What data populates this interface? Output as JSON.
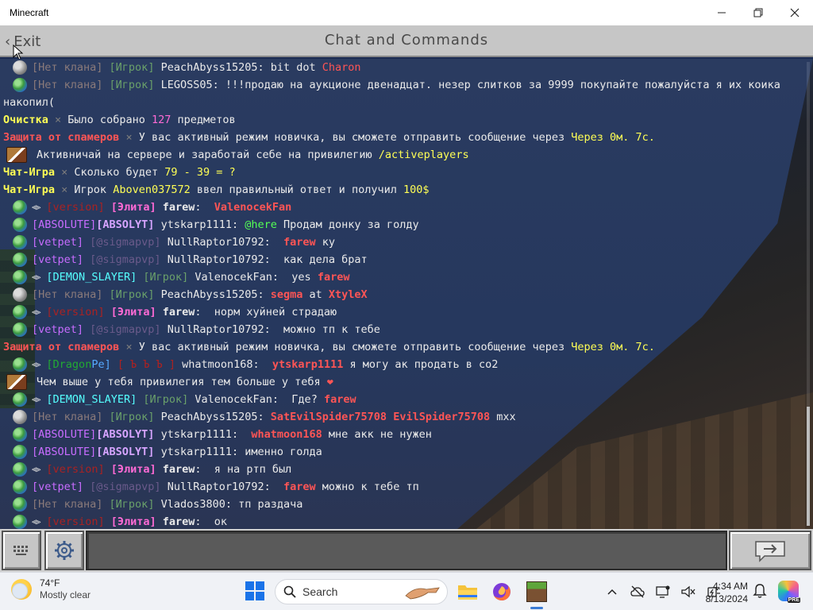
{
  "window": {
    "title": "Minecraft"
  },
  "header": {
    "exit_label": "Exit",
    "title": "Chat and Commands"
  },
  "colors": {
    "gray": "#7d7d7d",
    "white": "#eaeaea",
    "yellow": "#ffff55",
    "gold": "#ffd24a",
    "red": "#ff5555",
    "pink": "#ff6ad5",
    "purple": "#c86cff",
    "aqua": "#55ffff",
    "green": "#55ff55",
    "dark_red": "#aa2222",
    "dark_green": "#22aa33",
    "lavender": "#d6a4ff"
  },
  "chat_lines": [
    {
      "avatar": "gray",
      "wing": false,
      "segments": [
        {
          "t": "[Нет клана] ",
          "c": "#8a7a7a"
        },
        {
          "t": "[Игрок] ",
          "c": "#6aa06a"
        },
        {
          "t": "PeachAbyss15205",
          "c": "#eaeaea"
        },
        {
          "t": ": bit dot ",
          "c": "#eaeaea"
        },
        {
          "t": "Charon",
          "c": "#ff5555"
        }
      ]
    },
    {
      "avatar": "globe",
      "wing": false,
      "segments": [
        {
          "t": "[Нет клана] ",
          "c": "#8a7a7a"
        },
        {
          "t": "[Игрок] ",
          "c": "#6aa06a"
        },
        {
          "t": "LEGOSS05",
          "c": "#eaeaea"
        },
        {
          "t": ": !!!продаю на аукционе двенадцат. незер слитков за 9999 покупайте пожалуйста я их коика",
          "c": "#eaeaea"
        }
      ]
    },
    {
      "avatar": "none",
      "wing": false,
      "segments": [
        {
          "t": "накопил(",
          "c": "#eaeaea"
        }
      ]
    },
    {
      "avatar": "none",
      "wing": false,
      "segments": [
        {
          "t": "Очистка ",
          "c": "#ffff55",
          "b": true
        },
        {
          "t": "× ",
          "c": "#7d7d7d"
        },
        {
          "t": "Было собрано ",
          "c": "#eaeaea"
        },
        {
          "t": "127",
          "c": "#ff6ad5"
        },
        {
          "t": " предметов",
          "c": "#eaeaea"
        }
      ]
    },
    {
      "avatar": "none",
      "wing": false,
      "segments": [
        {
          "t": "Защита от спамеров ",
          "c": "#ff5555",
          "b": true
        },
        {
          "t": "× ",
          "c": "#7d7d7d"
        },
        {
          "t": "У вас активный режим новичка, вы сможете отправить сообщение через ",
          "c": "#eaeaea"
        },
        {
          "t": "Через 0м. 7с.",
          "c": "#ffff55"
        }
      ]
    },
    {
      "avatar": "book",
      "wing": false,
      "segments": [
        {
          "t": "Активничай на сервере и заработай себе на привилегию ",
          "c": "#eaeaea"
        },
        {
          "t": "/activeplayers",
          "c": "#ffff55"
        }
      ]
    },
    {
      "avatar": "none",
      "wing": false,
      "segments": [
        {
          "t": "Чат-Игра ",
          "c": "#ffff55",
          "b": true
        },
        {
          "t": "× ",
          "c": "#7d7d7d"
        },
        {
          "t": "Сколько будет ",
          "c": "#eaeaea"
        },
        {
          "t": "79 - 39 = ?",
          "c": "#ffff55"
        }
      ]
    },
    {
      "avatar": "none",
      "wing": false,
      "segments": [
        {
          "t": "Чат-Игра ",
          "c": "#ffff55",
          "b": true
        },
        {
          "t": "× ",
          "c": "#7d7d7d"
        },
        {
          "t": "Игрок ",
          "c": "#eaeaea"
        },
        {
          "t": "Aboven037572",
          "c": "#ffff55"
        },
        {
          "t": " ввел правильный ответ и получил ",
          "c": "#eaeaea"
        },
        {
          "t": "100$",
          "c": "#ffff55"
        }
      ]
    },
    {
      "avatar": "globe",
      "wing": true,
      "segments": [
        {
          "t": "[version] ",
          "c": "#aa2222"
        },
        {
          "t": "[Элита] ",
          "c": "#ff6ad5",
          "b": true
        },
        {
          "t": "farew",
          "c": "#eaeaea",
          "b": true
        },
        {
          "t": ":  ",
          "c": "#eaeaea"
        },
        {
          "t": "ValenocekFan",
          "c": "#ff5555",
          "b": true
        }
      ]
    },
    {
      "avatar": "globe",
      "wing": false,
      "segments": [
        {
          "t": "[ABSOLUTE]",
          "c": "#c86cff"
        },
        {
          "t": "[ABSOLYT] ",
          "c": "#d6a4ff",
          "b": true
        },
        {
          "t": "ytskarp1111",
          "c": "#eaeaea"
        },
        {
          "t": ": ",
          "c": "#eaeaea"
        },
        {
          "t": "@here",
          "c": "#55ff55"
        },
        {
          "t": " Продам донку за голду",
          "c": "#eaeaea"
        }
      ]
    },
    {
      "avatar": "globe",
      "wing": false,
      "segments": [
        {
          "t": "[vetpet] ",
          "c": "#c86cff"
        },
        {
          "t": "[@sigmapvp] ",
          "c": "#6a5a8a"
        },
        {
          "t": "NullRaptor10792",
          "c": "#eaeaea"
        },
        {
          "t": ":  ",
          "c": "#eaeaea"
        },
        {
          "t": "farew",
          "c": "#ff5555",
          "b": true
        },
        {
          "t": " ку",
          "c": "#eaeaea"
        }
      ]
    },
    {
      "avatar": "globe",
      "wing": false,
      "segments": [
        {
          "t": "[vetpet] ",
          "c": "#c86cff"
        },
        {
          "t": "[@sigmapvp] ",
          "c": "#6a5a8a"
        },
        {
          "t": "NullRaptor10792",
          "c": "#eaeaea"
        },
        {
          "t": ":  как дела брат",
          "c": "#eaeaea"
        }
      ]
    },
    {
      "avatar": "globe",
      "wing": true,
      "segments": [
        {
          "t": "[DEMON_SLAYER] ",
          "c": "#55ffff"
        },
        {
          "t": "[Игрок] ",
          "c": "#6aa06a"
        },
        {
          "t": "ValenocekFan",
          "c": "#eaeaea"
        },
        {
          "t": ":  yes ",
          "c": "#eaeaea"
        },
        {
          "t": "farew",
          "c": "#ff5555",
          "b": true
        }
      ]
    },
    {
      "avatar": "gray",
      "wing": false,
      "segments": [
        {
          "t": "[Нет клана] ",
          "c": "#8a7a7a"
        },
        {
          "t": "[Игрок] ",
          "c": "#6aa06a"
        },
        {
          "t": "PeachAbyss15205",
          "c": "#eaeaea"
        },
        {
          "t": ": ",
          "c": "#eaeaea"
        },
        {
          "t": "segma",
          "c": "#ff5555",
          "b": true
        },
        {
          "t": " at ",
          "c": "#eaeaea"
        },
        {
          "t": "XtyleX",
          "c": "#ff5555",
          "b": true
        }
      ]
    },
    {
      "avatar": "globe",
      "wing": true,
      "segments": [
        {
          "t": "[version] ",
          "c": "#aa2222"
        },
        {
          "t": "[Элита] ",
          "c": "#ff6ad5",
          "b": true
        },
        {
          "t": "farew",
          "c": "#eaeaea",
          "b": true
        },
        {
          "t": ":  норм хуйней страдаю",
          "c": "#eaeaea"
        }
      ]
    },
    {
      "avatar": "globe",
      "wing": false,
      "segments": [
        {
          "t": "[vetpet] ",
          "c": "#c86cff"
        },
        {
          "t": "[@sigmapvp] ",
          "c": "#6a5a8a"
        },
        {
          "t": "NullRaptor10792",
          "c": "#eaeaea"
        },
        {
          "t": ":  можно тп к тебе",
          "c": "#eaeaea"
        }
      ]
    },
    {
      "avatar": "none",
      "wing": false,
      "segments": [
        {
          "t": "Защита от спамеров ",
          "c": "#ff5555",
          "b": true
        },
        {
          "t": "× ",
          "c": "#7d7d7d"
        },
        {
          "t": "У вас активный режим новичка, вы сможете отправить сообщение через ",
          "c": "#eaeaea"
        },
        {
          "t": "Через 0м. 7с.",
          "c": "#ffff55"
        }
      ]
    },
    {
      "avatar": "globe",
      "wing": true,
      "segments": [
        {
          "t": "[Dragon",
          "c": "#22aa33"
        },
        {
          "t": "Pe] ",
          "c": "#55aaff"
        },
        {
          "t": "[ Ъ Ъ Ъ ] ",
          "c": "#aa2222"
        },
        {
          "t": "whatmoon168",
          "c": "#eaeaea"
        },
        {
          "t": ":  ",
          "c": "#eaeaea"
        },
        {
          "t": "ytskarp1111",
          "c": "#ff5555",
          "b": true
        },
        {
          "t": " я могу ак продать в co2",
          "c": "#eaeaea"
        }
      ]
    },
    {
      "avatar": "book",
      "wing": false,
      "segments": [
        {
          "t": "Чем выше у тебя привилегия тем больше у тебя ",
          "c": "#eaeaea"
        },
        {
          "t": "❤",
          "c": "#ff5555"
        }
      ]
    },
    {
      "avatar": "globe",
      "wing": true,
      "segments": [
        {
          "t": "[DEMON_SLAYER] ",
          "c": "#55ffff"
        },
        {
          "t": "[Игрок] ",
          "c": "#6aa06a"
        },
        {
          "t": "ValenocekFan",
          "c": "#eaeaea"
        },
        {
          "t": ":  Где? ",
          "c": "#eaeaea"
        },
        {
          "t": "farew",
          "c": "#ff5555",
          "b": true
        }
      ]
    },
    {
      "avatar": "gray",
      "wing": false,
      "segments": [
        {
          "t": "[Нет клана] ",
          "c": "#8a7a7a"
        },
        {
          "t": "[Игрок] ",
          "c": "#6aa06a"
        },
        {
          "t": "PeachAbyss15205",
          "c": "#eaeaea"
        },
        {
          "t": ": ",
          "c": "#eaeaea"
        },
        {
          "t": "SatEvilSpider75708 EvilSpider75708",
          "c": "#ff5555",
          "b": true
        },
        {
          "t": " mxx",
          "c": "#eaeaea"
        }
      ]
    },
    {
      "avatar": "globe",
      "wing": false,
      "segments": [
        {
          "t": "[ABSOLUTE]",
          "c": "#c86cff"
        },
        {
          "t": "[ABSOLYT] ",
          "c": "#d6a4ff",
          "b": true
        },
        {
          "t": "ytskarp1111",
          "c": "#eaeaea"
        },
        {
          "t": ":  ",
          "c": "#eaeaea"
        },
        {
          "t": "whatmoon168",
          "c": "#ff5555",
          "b": true
        },
        {
          "t": " мне акк не нужен",
          "c": "#eaeaea"
        }
      ]
    },
    {
      "avatar": "globe",
      "wing": false,
      "segments": [
        {
          "t": "[ABSOLUTE]",
          "c": "#c86cff"
        },
        {
          "t": "[ABSOLYT] ",
          "c": "#d6a4ff",
          "b": true
        },
        {
          "t": "ytskarp1111",
          "c": "#eaeaea"
        },
        {
          "t": ": именно голда",
          "c": "#eaeaea"
        }
      ]
    },
    {
      "avatar": "globe",
      "wing": true,
      "segments": [
        {
          "t": "[version] ",
          "c": "#aa2222"
        },
        {
          "t": "[Элита] ",
          "c": "#ff6ad5",
          "b": true
        },
        {
          "t": "farew",
          "c": "#eaeaea",
          "b": true
        },
        {
          "t": ":  я на ртп был",
          "c": "#eaeaea"
        }
      ]
    },
    {
      "avatar": "globe",
      "wing": false,
      "segments": [
        {
          "t": "[vetpet] ",
          "c": "#c86cff"
        },
        {
          "t": "[@sigmapvp] ",
          "c": "#6a5a8a"
        },
        {
          "t": "NullRaptor10792",
          "c": "#eaeaea"
        },
        {
          "t": ":  ",
          "c": "#eaeaea"
        },
        {
          "t": "farew",
          "c": "#ff5555",
          "b": true
        },
        {
          "t": " можно к тебе тп",
          "c": "#eaeaea"
        }
      ]
    },
    {
      "avatar": "globe",
      "wing": false,
      "segments": [
        {
          "t": "[Нет клана] ",
          "c": "#8a7a7a"
        },
        {
          "t": "[Игрок] ",
          "c": "#6aa06a"
        },
        {
          "t": "Vlados3800",
          "c": "#eaeaea"
        },
        {
          "t": ": тп раздача",
          "c": "#eaeaea"
        }
      ]
    },
    {
      "avatar": "globe",
      "wing": true,
      "segments": [
        {
          "t": "[version] ",
          "c": "#aa2222"
        },
        {
          "t": "[Элита] ",
          "c": "#ff6ad5",
          "b": true
        },
        {
          "t": "farew",
          "c": "#eaeaea",
          "b": true
        },
        {
          "t": ":  ок",
          "c": "#eaeaea"
        }
      ]
    }
  ],
  "input": {
    "value": "",
    "placeholder": ""
  },
  "taskbar": {
    "weather_temp": "74°F",
    "weather_cond": "Mostly clear",
    "search_label": "Search",
    "time": "4:34 AM",
    "date": "8/13/2024",
    "copilot_badge": "PRE"
  }
}
